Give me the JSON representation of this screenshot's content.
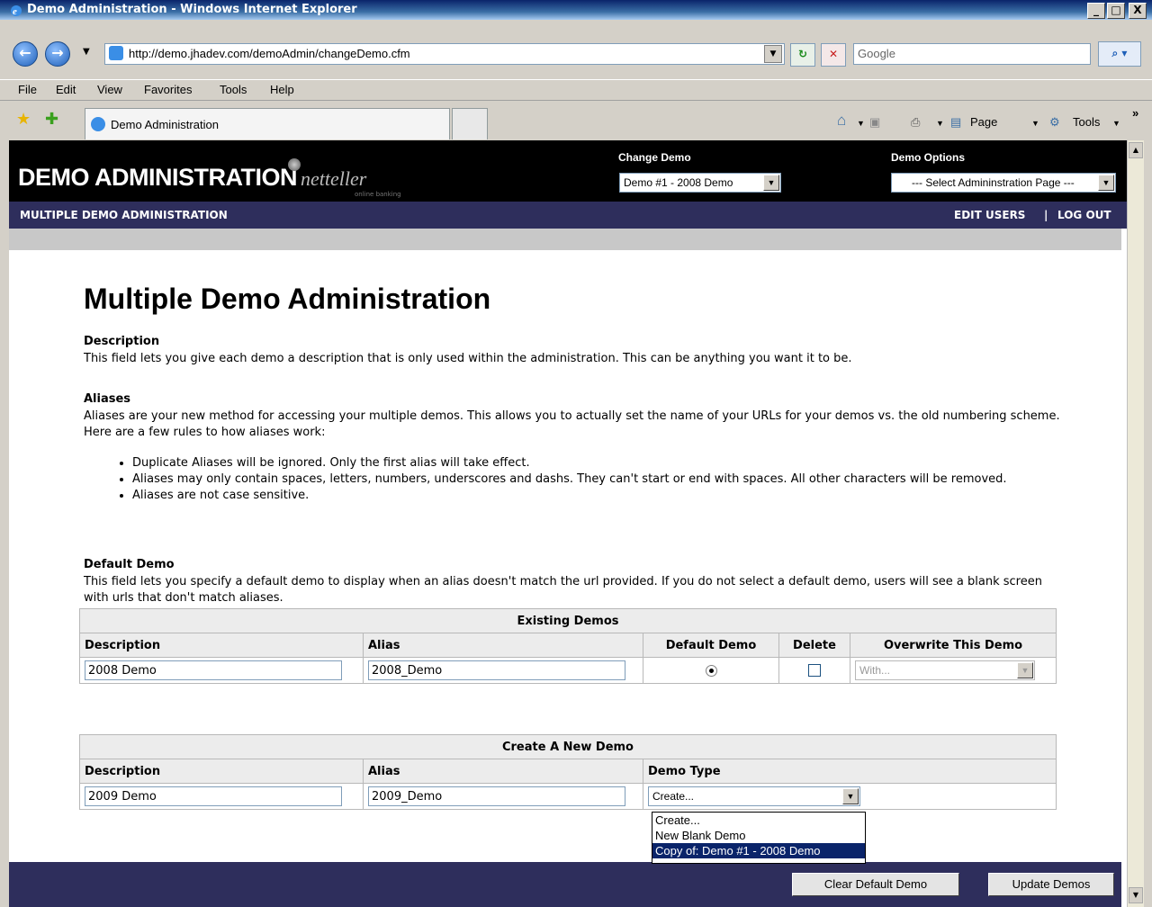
{
  "window": {
    "title": "Demo Administration - Windows Internet Explorer",
    "minimize": "_",
    "maximize": "□",
    "close": "X"
  },
  "address": {
    "url": "http://demo.jhadev.com/demoAdmin/changeDemo.cfm",
    "search_placeholder": "Google"
  },
  "menu": [
    "File",
    "Edit",
    "View",
    "Favorites",
    "Tools",
    "Help"
  ],
  "tab": {
    "title": "Demo Administration"
  },
  "toolbar": {
    "page": "Page",
    "tools": "Tools"
  },
  "header": {
    "logo": "DEMO ADMINISTRATION",
    "brand": "netteller",
    "brand_sub": "online banking",
    "change_demo_label": "Change Demo",
    "change_demo_value": "Demo #1 - 2008 Demo",
    "demo_options_label": "Demo Options",
    "demo_options_value": "--- Select Admininstration Page ---"
  },
  "nav": {
    "left": "MULTIPLE DEMO ADMINISTRATION",
    "edit_users": "EDIT USERS",
    "separator": "|",
    "logout": "LOG OUT"
  },
  "page": {
    "title": "Multiple Demo Administration",
    "description_title": "Description",
    "description_text": "This field lets you give each demo a description that is only used within the administration. This can be anything you want it to be.",
    "aliases_title": "Aliases",
    "aliases_text": "Aliases are your new method for accessing your multiple demos. This allows you to actually set the name of your URLs for your demos vs. the old numbering scheme. Here are a few rules to how aliases work:",
    "rules": [
      "Duplicate Aliases will be ignored. Only the first alias will take effect.",
      "Aliases may only contain spaces, letters, numbers, underscores and dashs. They can't start or end with spaces. All other characters will be removed.",
      "Aliases are not case sensitive."
    ],
    "default_title": "Default Demo",
    "default_text": "This field lets you specify a default demo to display when an alias doesn't match the url provided. If you do not select a default demo, users will see a blank screen with urls that don't match aliases."
  },
  "existing": {
    "caption": "Existing Demos",
    "headers": [
      "Description",
      "Alias",
      "Default Demo",
      "Delete",
      "Overwrite This Demo"
    ],
    "row": {
      "description": "2008 Demo",
      "alias": "2008_Demo",
      "default_selected": true,
      "delete_checked": false,
      "overwrite_value": "With..."
    }
  },
  "create": {
    "caption": "Create A New Demo",
    "headers": [
      "Description",
      "Alias",
      "Demo Type"
    ],
    "row": {
      "description": "2009 Demo",
      "alias": "2009_Demo",
      "type_value": "Create..."
    },
    "options": [
      "Create...",
      "New Blank Demo",
      "Copy of: Demo #1 - 2008 Demo"
    ],
    "highlighted_option": 2
  },
  "buttons": {
    "clear_default": "Clear Default Demo",
    "update": "Update Demos"
  },
  "colors": {
    "header_bg": "#000000",
    "nav_bg": "#2e2e5c",
    "dropdown_highlight": "#0a246a"
  }
}
